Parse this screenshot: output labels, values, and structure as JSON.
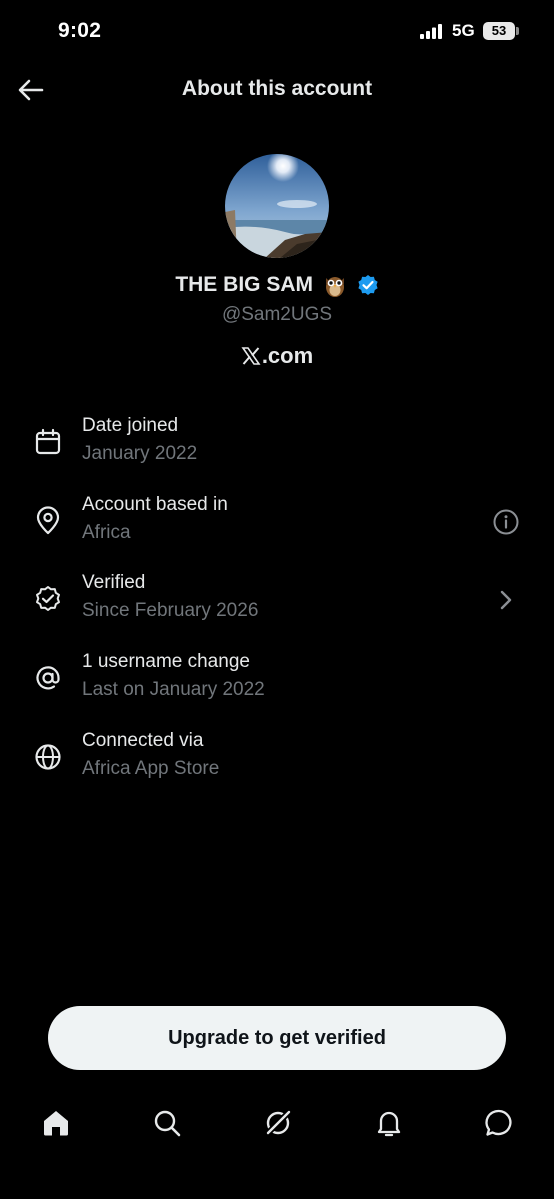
{
  "status_bar": {
    "time": "9:02",
    "network": "5G",
    "battery": "53"
  },
  "header": {
    "title": "About this account",
    "back_icon": "arrow-left-icon"
  },
  "profile": {
    "display_name": "THE BIG SAM",
    "emoji_icon": "owl-icon",
    "badge_icon": "verified-badge-icon",
    "badge_color": "#1d9bf0",
    "handle": "@Sam2UGS",
    "platform": ".com",
    "platform_logo_icon": "x-logo-icon"
  },
  "info_rows": [
    {
      "icon": "calendar-icon",
      "title": "Date joined",
      "subtitle": "January 2022"
    },
    {
      "icon": "location-pin-icon",
      "title": "Account based in",
      "subtitle": "Africa",
      "action_icon": "info-circle-icon"
    },
    {
      "icon": "verified-outline-icon",
      "title": "Verified",
      "subtitle": "Since February 2026",
      "action_icon": "chevron-right-icon"
    },
    {
      "icon": "at-sign-icon",
      "title": "1 username change",
      "subtitle": "Last on January 2022"
    },
    {
      "icon": "globe-icon",
      "title": "Connected via",
      "subtitle": "Africa App Store"
    }
  ],
  "upgrade_button": {
    "label": "Upgrade to get verified"
  },
  "bottom_nav": [
    {
      "icon": "home-icon",
      "active": true
    },
    {
      "icon": "search-icon",
      "active": false
    },
    {
      "icon": "grok-icon",
      "active": false
    },
    {
      "icon": "bell-icon",
      "active": false
    },
    {
      "icon": "messages-icon",
      "active": false
    }
  ],
  "colors": {
    "background": "#000000",
    "primary_text": "#e7e9ea",
    "secondary_text": "#71767b",
    "button_background": "#eff3f4"
  }
}
